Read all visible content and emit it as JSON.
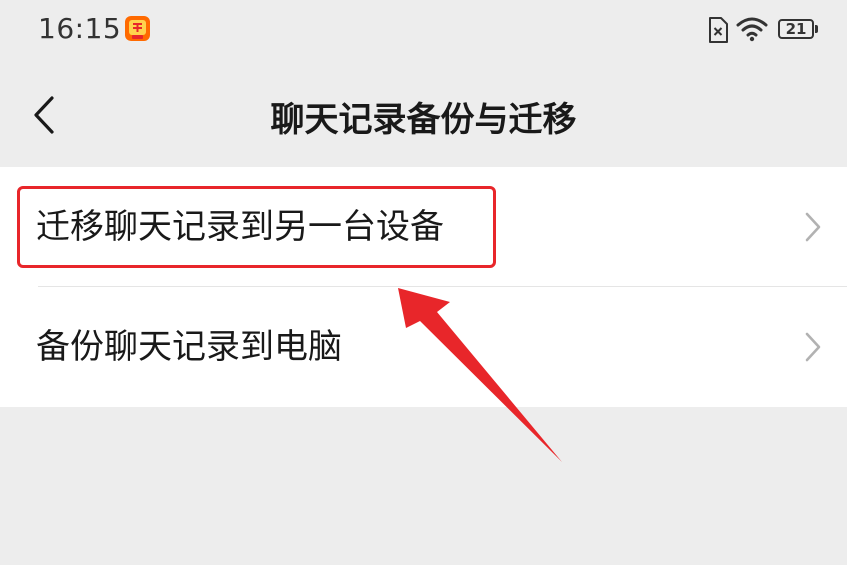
{
  "status_bar": {
    "time": "16:15",
    "app_badge_icon": "taobao-badge-icon",
    "battery_level": "21"
  },
  "nav": {
    "title": "聊天记录备份与迁移",
    "back_icon": "chevron-left-icon"
  },
  "settings": {
    "items": [
      {
        "label": "迁移聊天记录到另一台设备",
        "icon": "chevron-right-icon"
      },
      {
        "label": "备份聊天记录到电脑",
        "icon": "chevron-right-icon"
      }
    ]
  },
  "annotation": {
    "color": "#e8262a"
  },
  "colors": {
    "background": "#ededed",
    "card": "#ffffff",
    "text": "#191919",
    "chevron": "#b2b2b2"
  }
}
